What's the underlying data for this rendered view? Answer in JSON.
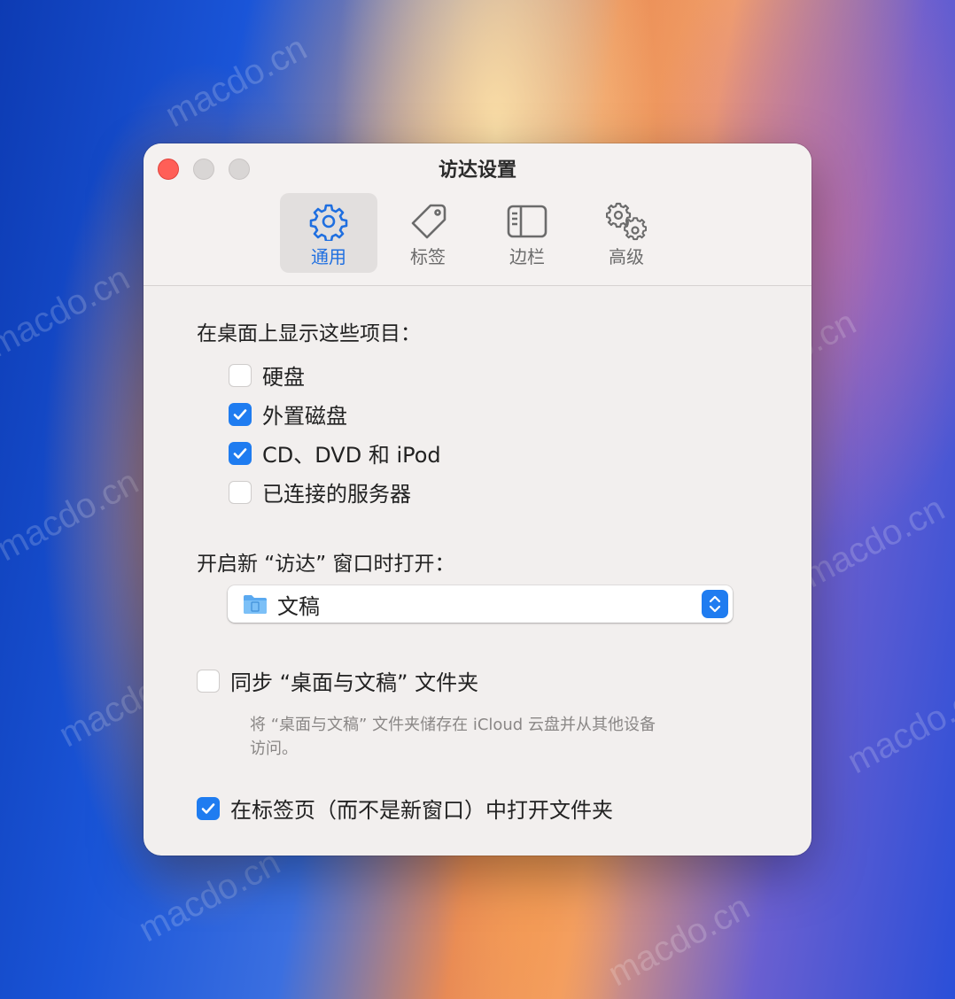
{
  "window": {
    "title": "访达设置"
  },
  "tabs": [
    {
      "label": "通用",
      "icon": "gear-icon",
      "active": true
    },
    {
      "label": "标签",
      "icon": "tag-icon",
      "active": false
    },
    {
      "label": "边栏",
      "icon": "sidebar-icon",
      "active": false
    },
    {
      "label": "高级",
      "icon": "gears-icon",
      "active": false
    }
  ],
  "desktop_items": {
    "label": "在桌面上显示这些项目：",
    "options": [
      {
        "label": "硬盘",
        "checked": false
      },
      {
        "label": "外置磁盘",
        "checked": true
      },
      {
        "label": "CD、DVD 和 iPod",
        "checked": true
      },
      {
        "label": "已连接的服务器",
        "checked": false
      }
    ]
  },
  "new_window": {
    "label": "开启新 “访达” 窗口时打开：",
    "selected": "文稿",
    "icon": "folder-icon"
  },
  "sync": {
    "label": "同步 “桌面与文稿” 文件夹",
    "checked": false,
    "note": "将 “桌面与文稿” 文件夹储存在 iCloud 云盘并从其他设备访问。"
  },
  "open_in_tabs": {
    "label": "在标签页（而不是新窗口）中打开文件夹",
    "checked": true
  },
  "watermark": "macdo.cn",
  "colors": {
    "accent": "#1f7cf0",
    "close_button": "#ff5f57"
  }
}
